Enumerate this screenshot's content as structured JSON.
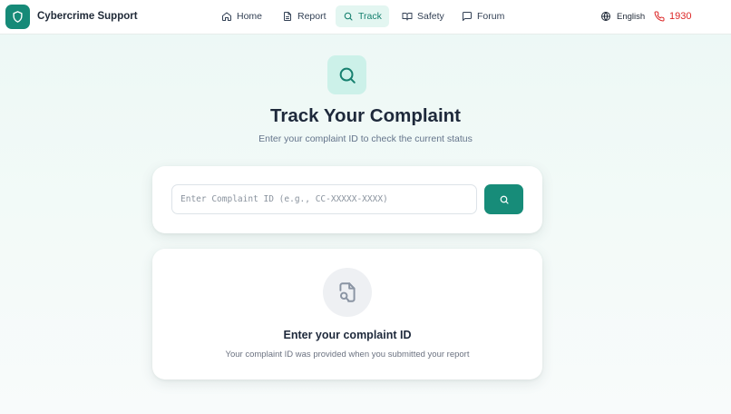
{
  "app": {
    "name": "Cybercrime Support",
    "logo_icon": "shield-icon"
  },
  "nav": {
    "items": [
      {
        "label": "Home",
        "icon": "home-icon",
        "active": false
      },
      {
        "label": "Report",
        "icon": "document-icon",
        "active": false
      },
      {
        "label": "Track",
        "icon": "search-icon",
        "active": true
      },
      {
        "label": "Safety",
        "icon": "book-icon",
        "active": false
      },
      {
        "label": "Forum",
        "icon": "chat-icon",
        "active": false
      }
    ],
    "language": "English",
    "helpline": "1930"
  },
  "hero": {
    "icon": "search-icon",
    "title": "Track Your Complaint",
    "subtitle": "Enter your complaint ID to check the current status"
  },
  "search": {
    "value": "",
    "placeholder": "Enter Complaint ID (e.g., CC-XXXXX-XXXX)",
    "button_icon": "search-icon"
  },
  "empty_state": {
    "icon": "file-search-icon",
    "title": "Enter your complaint ID",
    "hint": "Your complaint ID was provided when you submitted your report"
  },
  "colors": {
    "brand": "#168a78",
    "active_nav_bg": "#e3f6f1",
    "helpline": "#dc2626",
    "page_bg": "#ecf8f5"
  }
}
